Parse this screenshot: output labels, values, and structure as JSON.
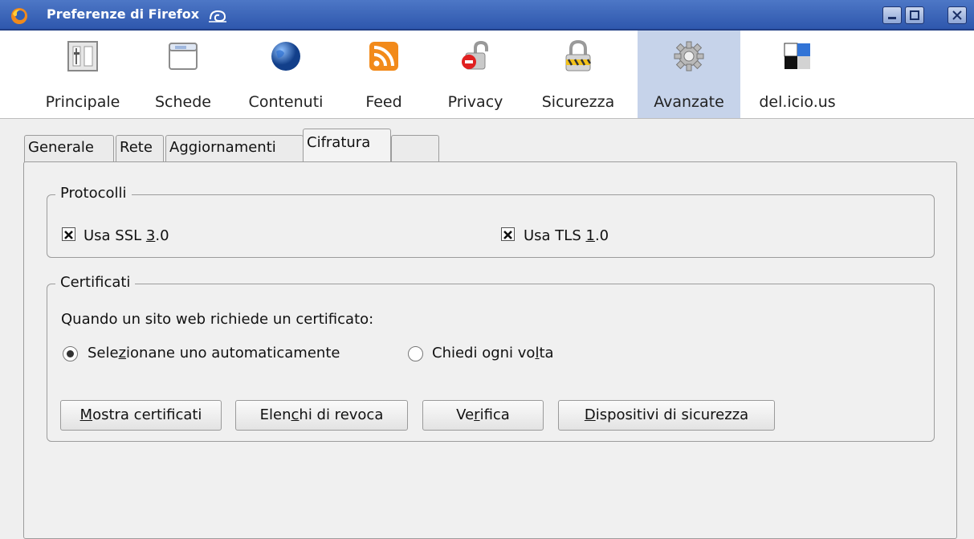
{
  "window": {
    "title": "Preferenze di Firefox"
  },
  "toolbar": {
    "items": [
      {
        "label": "Principale",
        "icon": "switch-icon"
      },
      {
        "label": "Schede",
        "icon": "tabs-window-icon"
      },
      {
        "label": "Contenuti",
        "icon": "globe-icon"
      },
      {
        "label": "Feed",
        "icon": "rss-feed-icon"
      },
      {
        "label": "Privacy",
        "icon": "lock-open-icon"
      },
      {
        "label": "Sicurezza",
        "icon": "padlock-warning-icon"
      },
      {
        "label": "Avanzate",
        "icon": "gear-icon"
      },
      {
        "label": "del.icio.us",
        "icon": "delicious-icon"
      }
    ],
    "active": "Avanzate"
  },
  "tabs": [
    {
      "label": "Generale"
    },
    {
      "label": "Rete"
    },
    {
      "label": "Aggiornamenti"
    },
    {
      "label": "Cifratura"
    },
    {
      "label": ""
    }
  ],
  "active_tab": "Cifratura",
  "protocols": {
    "legend": "Protocolli",
    "ssl": {
      "pre": "Usa SSL ",
      "accel": "3",
      "post": ".0",
      "checked": true
    },
    "tls": {
      "pre": "Usa TLS ",
      "accel": "1",
      "post": ".0",
      "checked": true
    }
  },
  "certificates": {
    "legend": "Certificati",
    "prompt": "Quando un sito web richiede un certificato:",
    "radio_auto": {
      "pre": "Sele",
      "accel": "z",
      "post": "ionane uno automaticamente",
      "selected": true
    },
    "radio_ask": {
      "pre": "Chiedi ogni vo",
      "accel": "l",
      "post": "ta",
      "selected": false
    },
    "buttons": {
      "show": {
        "pre": "",
        "accel": "M",
        "post": "ostra certificati"
      },
      "revocation": {
        "pre": "Elen",
        "accel": "c",
        "post": "hi di revoca"
      },
      "verify": {
        "pre": "Ve",
        "accel": "r",
        "post": "ifica"
      },
      "devices": {
        "pre": "",
        "accel": "D",
        "post": "ispositivi di sicurezza"
      }
    }
  },
  "colors": {
    "titlebar": "#3a63b8",
    "toolbar_active": "#c6d3ea"
  }
}
